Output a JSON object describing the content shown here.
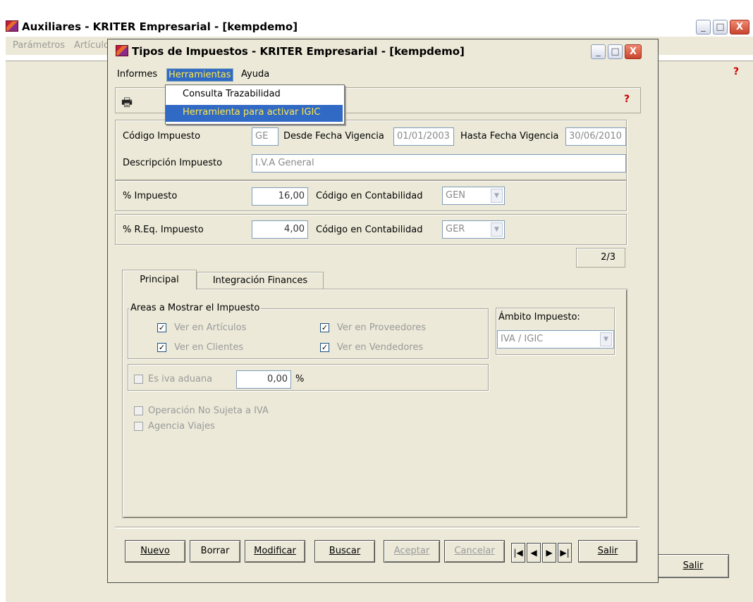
{
  "main_window": {
    "title": "Auxiliares - KRITER Empresarial - [kempdemo]",
    "menu": [
      "Parámetros",
      "Artículo"
    ],
    "salir_label": "Salir",
    "controls": {
      "minimize": "_",
      "maximize": "□",
      "close": "X"
    }
  },
  "dialog": {
    "title": "Tipos de Impuestos - KRITER Empresarial - [kempdemo]",
    "menu": [
      "Informes",
      "Herramientas",
      "Ayuda"
    ],
    "active_menu": "Herramientas",
    "dropdown": [
      "Consulta Trazabilidad",
      "Herramienta para activar IGIC"
    ],
    "highlighted_dropdown": "Herramienta para activar IGIC",
    "form": {
      "codigo_label": "Código Impuesto",
      "codigo_value": "GE",
      "desde_label": "Desde Fecha Vigencia",
      "desde_value": "01/01/2003",
      "hasta_label": "Hasta Fecha Vigencia",
      "hasta_value": "30/06/2010",
      "descripcion_label": "Descripción Impuesto",
      "descripcion_value": "I.V.A General",
      "impuesto_label": "% Impuesto",
      "impuesto_value": "16,00",
      "contab_label": "Código en Contabilidad",
      "contab1_value": "GEN",
      "req_label": "% R.Eq. Impuesto",
      "req_value": "4,00",
      "contab2_value": "GER",
      "record_counter": "2/3"
    },
    "tabs": [
      "Principal",
      "Integración Finances"
    ],
    "active_tab": "Principal",
    "areas": {
      "legend": "Areas a Mostrar el Impuesto",
      "items": [
        {
          "label": "Ver en Artículos",
          "checked": true
        },
        {
          "label": "Ver en Proveedores",
          "checked": true
        },
        {
          "label": "Ver en Clientes",
          "checked": true
        },
        {
          "label": "Ver en Vendedores",
          "checked": true
        }
      ]
    },
    "aduana": {
      "label": "Es iva aduana",
      "value": "0,00",
      "unit": "%",
      "checked": false
    },
    "no_sujeta": {
      "label": "Operación No Sujeta a IVA",
      "checked": false
    },
    "agencia": {
      "label": "Agencia Viajes",
      "checked": false
    },
    "ambito": {
      "label": "Ámbito Impuesto:",
      "value": "IVA / IGIC"
    },
    "buttons": {
      "nuevo": "Nuevo",
      "borrar": "Borrar",
      "modificar": "Modificar",
      "buscar": "Buscar",
      "aceptar": "Aceptar",
      "cancelar": "Cancelar",
      "salir": "Salir"
    },
    "nav": {
      "first": "|◀",
      "prev": "◀",
      "next": "▶",
      "last": "▶|"
    }
  }
}
